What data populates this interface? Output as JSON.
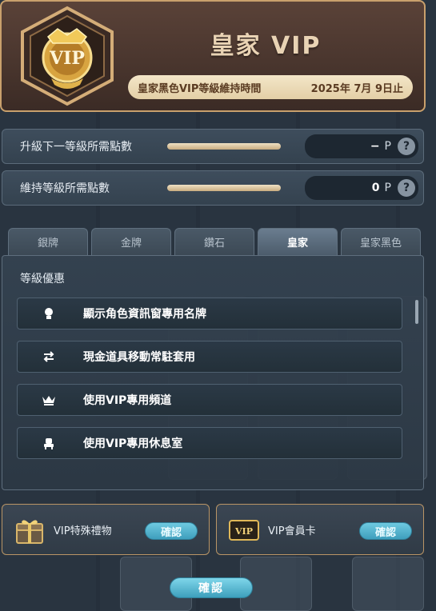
{
  "header": {
    "title": "皇家 VIP",
    "badge_text": "VIP",
    "maintain_label": "皇家黑色VIP等級維持時間",
    "maintain_date": "2025年  7月  9日止"
  },
  "points": [
    {
      "label": "升級下一等級所需點數",
      "value": "−",
      "unit": "P"
    },
    {
      "label": "維持等級所需點數",
      "value": "0",
      "unit": "P"
    }
  ],
  "help_glyph": "?",
  "tabs": [
    {
      "label": "銀牌"
    },
    {
      "label": "金牌"
    },
    {
      "label": "鑽石"
    },
    {
      "label": "皇家",
      "active": true
    },
    {
      "label": "皇家黑色"
    }
  ],
  "benefits": {
    "title": "等級優惠",
    "items": [
      {
        "icon": "nameplate-icon",
        "label": "顯示角色資訊窗專用名牌"
      },
      {
        "icon": "swap-arrows-icon",
        "label": "現金道具移動常駐套用"
      },
      {
        "icon": "crown-icon",
        "label": "使用VIP專用頻道"
      },
      {
        "icon": "lounge-chair-icon",
        "label": "使用VIP專用休息室"
      }
    ]
  },
  "cards": [
    {
      "icon": "gift-chest-icon",
      "label": "VIP特殊禮物",
      "button": "確認"
    },
    {
      "icon": "vip-card-icon",
      "label": "VIP會員卡",
      "button": "確認"
    }
  ],
  "confirm_label": "確認",
  "colors": {
    "accent_gold": "#c9a06c",
    "button_blue": "#3f9fbd",
    "panel_bg": "#34424f"
  }
}
